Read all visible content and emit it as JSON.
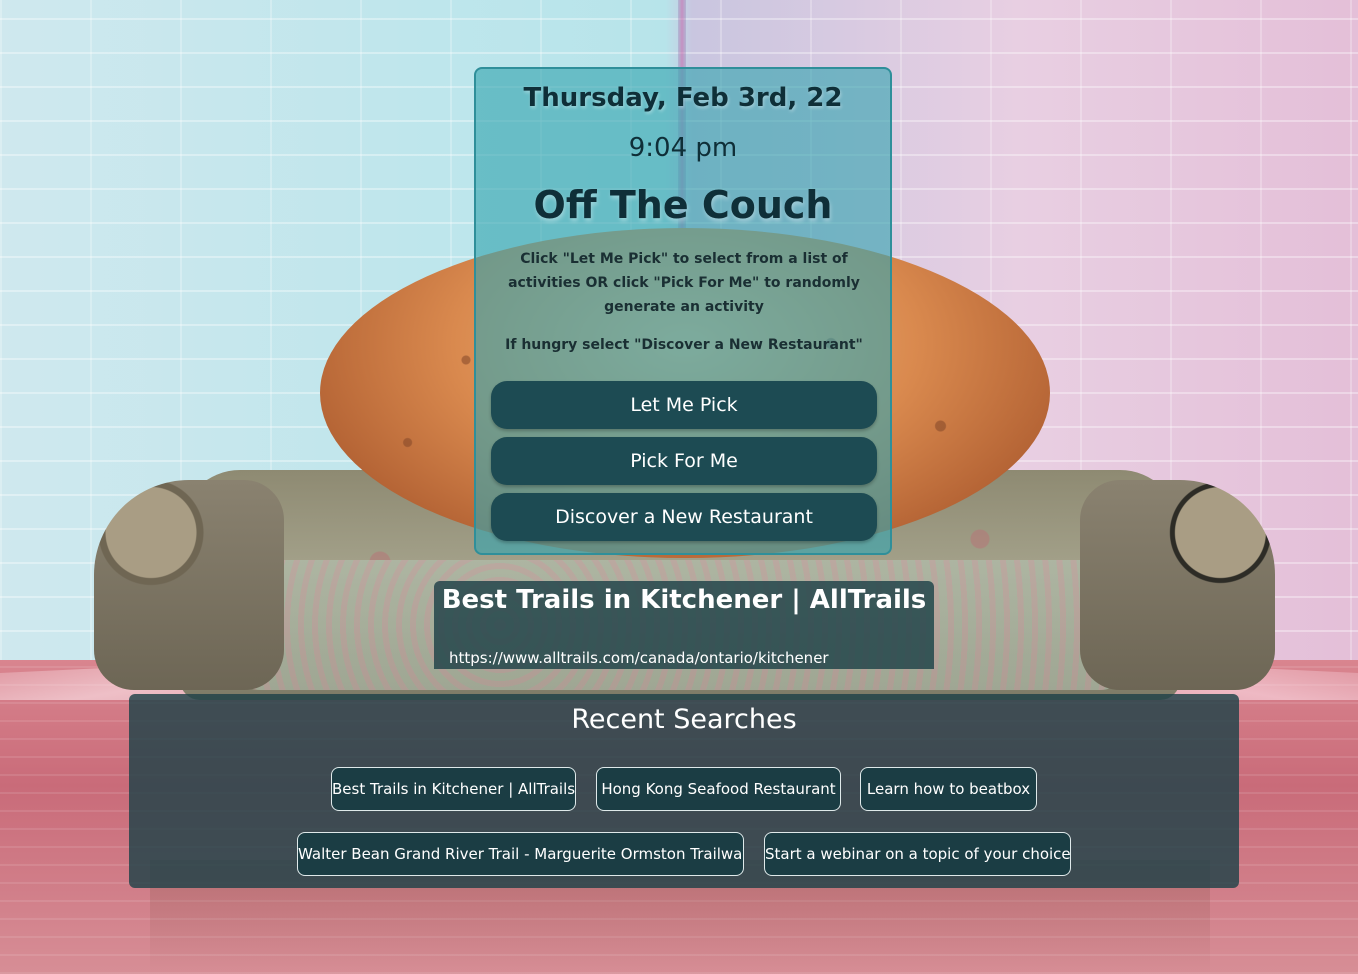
{
  "header": {
    "date": "Thursday, Feb 3rd, 22",
    "time": "9:04 pm",
    "title": "Off The Couch"
  },
  "instructions": {
    "main": "Click \"Let Me Pick\" to select from a list of activities OR click \"Pick For Me\" to randomly generate an activity",
    "hungry": "If hungry select \"Discover a New Restaurant\""
  },
  "buttons": {
    "let_me_pick": "Let Me Pick",
    "pick_for_me": "Pick For Me",
    "discover_restaurant": "Discover a New Restaurant"
  },
  "result": {
    "title": "Best Trails in Kitchener | AllTrails",
    "url": "https://www.alltrails.com/canada/ontario/kitchener"
  },
  "recent_searches": {
    "title": "Recent Searches",
    "items": [
      "Best Trails in Kitchener | AllTrails",
      "Hong Kong Seafood Restaurant",
      "Learn how to beatbox",
      "Walter Bean Grand River Trail - Marguerite Ormston Trailway",
      "Start a webinar on a topic of your choice"
    ]
  },
  "colors": {
    "card_background": "#36a5b0",
    "button_background": "#1d4b53",
    "panel_background": "#1e4248",
    "heading_text": "#0f2f38"
  }
}
